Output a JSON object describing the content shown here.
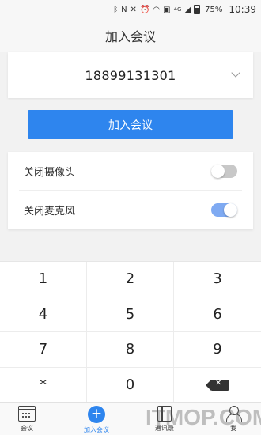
{
  "status_bar": {
    "icons": [
      "bluetooth-icon",
      "nfc-icon",
      "mute-icon",
      "alarm-icon",
      "wifi-icon",
      "screenshot-icon",
      "4g-icon",
      "signal-icon",
      "battery-icon"
    ],
    "network": "4G",
    "battery": "75%",
    "time": "10:39"
  },
  "header": {
    "title": "加入会议"
  },
  "meeting": {
    "number": "18899131301"
  },
  "join_button": {
    "label": "加入会议"
  },
  "settings": {
    "camera_label": "关闭摄像头",
    "camera_on": false,
    "mic_label": "关闭麦克风",
    "mic_on": true,
    "toggle_on_color": "#7faaf2",
    "toggle_off_color": "#c8c8c8"
  },
  "keypad": {
    "keys": [
      "1",
      "2",
      "3",
      "4",
      "5",
      "6",
      "7",
      "8",
      "9",
      "*",
      "0"
    ]
  },
  "bottom_nav": {
    "items": [
      {
        "label": "会议",
        "icon": "calendar-icon"
      },
      {
        "label": "加入会议",
        "icon": "plus-icon"
      },
      {
        "label": "通讯录",
        "icon": "contacts-icon"
      },
      {
        "label": "我",
        "icon": "person-icon"
      }
    ],
    "active_color": "#2e85ee"
  },
  "watermark": "ITMOP.COM"
}
